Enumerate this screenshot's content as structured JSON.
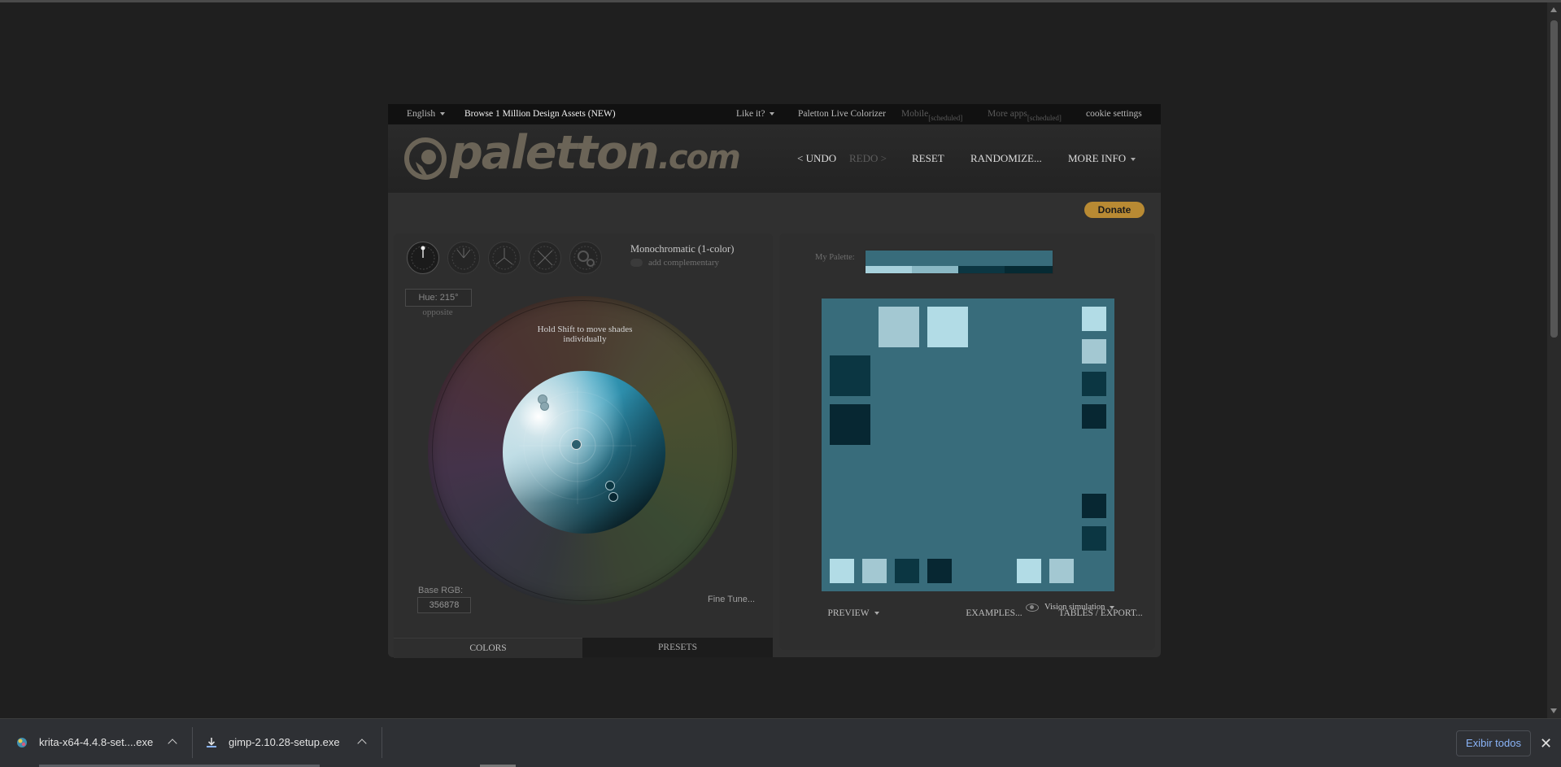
{
  "topbar": {
    "language": "English",
    "browse": "Browse 1 Million Design Assets (NEW)",
    "like_it": "Like it?",
    "live_colorizer": "Paletton Live Colorizer",
    "mobile": "Mobile",
    "mobile_tag": "[scheduled]",
    "more_apps": "More apps",
    "more_apps_tag": "[scheduled]",
    "cookie": "cookie settings"
  },
  "header": {
    "logo_text": "paletton",
    "logo_domain": ".com",
    "undo": "< UNDO",
    "redo": "REDO >",
    "reset": "RESET",
    "randomize": "RANDOMIZE...",
    "more_info": "MORE INFO"
  },
  "donate": "Donate",
  "colors_panel": {
    "mode_title": "Monochromatic (1-color)",
    "add_complementary": "add complementary",
    "hue": "Hue: 215°",
    "opposite": "opposite",
    "hint": "Hold Shift to move shades individually",
    "base_rgb_label": "Base RGB:",
    "base_rgb_value": "356878",
    "fine_tune": "Fine Tune...",
    "tab_colors": "COLORS",
    "tab_presets": "PRESETS"
  },
  "preview_panel": {
    "my_palette_label": "My Palette:",
    "palette": {
      "base": "#386c7b",
      "shades": [
        "#a7d1dc",
        "#8ab8c4",
        "#0c3642",
        "#062a33"
      ]
    },
    "preview_colors": {
      "background": "#386c7b",
      "light1": "#a3c8d2",
      "light2": "#b2dce6",
      "dark1": "#0b3642",
      "dark2": "#072732"
    },
    "vision_simulation": "Vision simulation",
    "tab_preview": "PREVIEW",
    "tab_examples": "EXAMPLES...",
    "tab_tables": "TABLES / EXPORT..."
  },
  "downloads": {
    "items": [
      {
        "name": "krita-x64-4.4.8-set....exe",
        "icon": "krita-icon"
      },
      {
        "name": "gimp-2.10.28-setup.exe",
        "icon": "download-icon"
      }
    ],
    "show_all": "Exibir todos"
  }
}
